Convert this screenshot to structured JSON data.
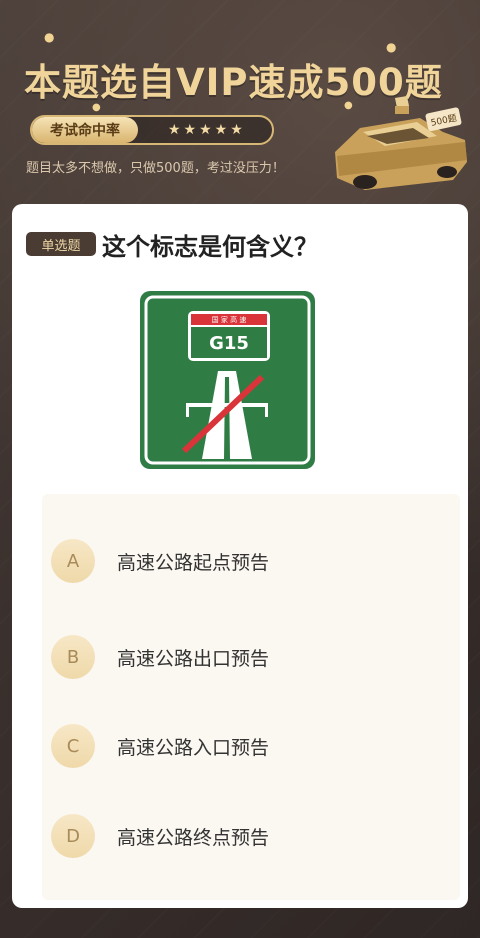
{
  "hero": {
    "title": "本题选自VIP速成500题",
    "rate_label": "考试命中率",
    "stars": "★★★★★",
    "subtitle": "题目太多不想做，只做500题，考过没压力！",
    "car_plate": "500题"
  },
  "question": {
    "type_badge": "单选题",
    "text": "这个标志是何含义？",
    "sign": {
      "top_label": "国 家 高 速",
      "route": "G15",
      "background_color": "#2f7d45",
      "cross_color": "#d9343a"
    }
  },
  "options": [
    {
      "letter": "A",
      "text": "高速公路起点预告"
    },
    {
      "letter": "B",
      "text": "高速公路出口预告"
    },
    {
      "letter": "C",
      "text": "高速公路入口预告"
    },
    {
      "letter": "D",
      "text": "高速公路终点预告"
    }
  ],
  "colors": {
    "gold": "#f0d49a",
    "dark_brown": "#3d3431",
    "badge_bg": "#4a3c33"
  }
}
